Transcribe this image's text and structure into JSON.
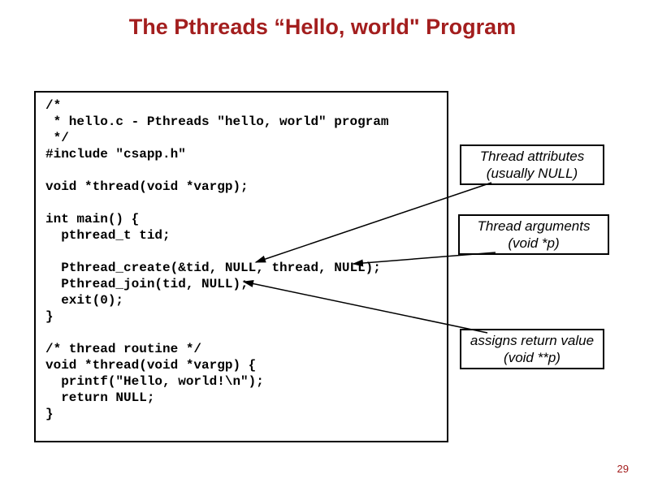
{
  "title": "The Pthreads “Hello, world\" Program",
  "code": "/*\n * hello.c - Pthreads \"hello, world\" program\n */\n#include \"csapp.h\"\n\nvoid *thread(void *vargp);\n\nint main() {\n  pthread_t tid;\n\n  Pthread_create(&tid, NULL, thread, NULL);\n  Pthread_join(tid, NULL);\n  exit(0);\n}\n\n/* thread routine */\nvoid *thread(void *vargp) {\n  printf(\"Hello, world!\\n\");\n  return NULL;\n}",
  "notes": {
    "attr_line1": "Thread attributes",
    "attr_line2": "(usually NULL)",
    "args_line1": "Thread arguments",
    "args_line2": "(void *p)",
    "ret_line1": "assigns return value",
    "ret_line2": "(void **p)"
  },
  "page_number": "29"
}
